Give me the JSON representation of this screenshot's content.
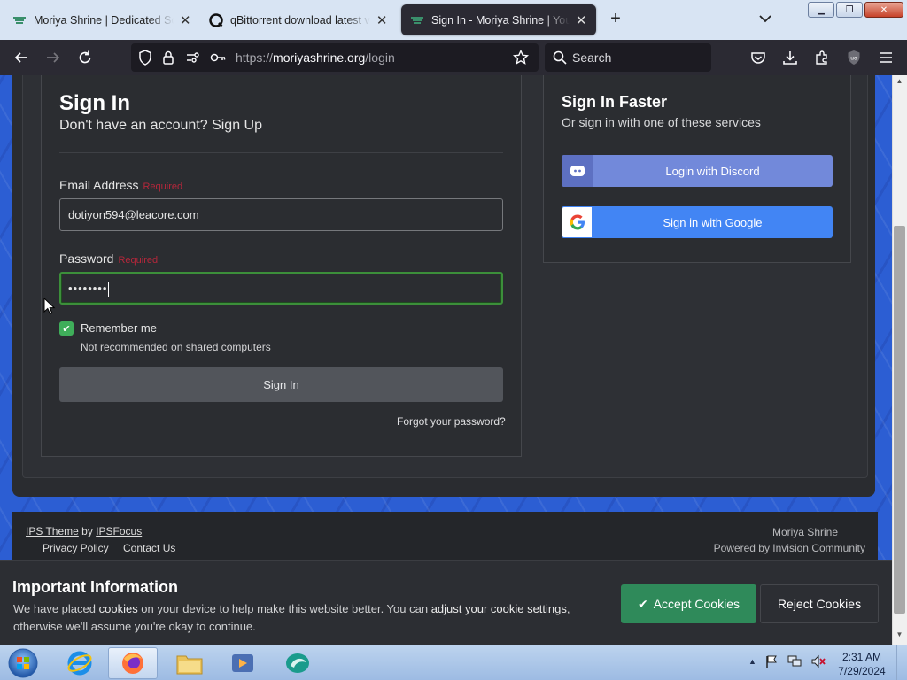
{
  "browser": {
    "tabs": [
      {
        "label": "Moriya Shrine | Dedicated Sound",
        "active": false
      },
      {
        "label": "qBittorrent download latest version",
        "active": false
      },
      {
        "label": "Sign In - Moriya Shrine | Your resource",
        "active": true
      }
    ],
    "url_domain": "moriyashrine.org",
    "url_prefix": "https://",
    "url_path": "/login",
    "search_placeholder": "Search"
  },
  "signin": {
    "title": "Sign In",
    "subtitle": "Don't have an account? Sign Up",
    "email_label": "Email Address",
    "email_required": "Required",
    "email_value": "dotiyon594@leacore.com",
    "password_label": "Password",
    "password_required": "Required",
    "password_value": "••••••••",
    "remember_label": "Remember me",
    "remember_checked": true,
    "remember_note": "Not recommended on shared computers",
    "submit_label": "Sign In",
    "forgot_label": "Forgot your password?"
  },
  "faster": {
    "title": "Sign In Faster",
    "subtitle": "Or sign in with one of these services",
    "discord_label": "Login with Discord",
    "google_label": "Sign in with Google",
    "discord_color": "#7289da",
    "google_color": "#4285f4"
  },
  "footer": {
    "theme_text": "IPS Theme",
    "by_text": "by",
    "focus_text": "IPSFocus",
    "privacy": "Privacy Policy",
    "contact": "Contact Us",
    "site_name": "Moriya Shrine",
    "powered": "Powered by Invision Community"
  },
  "cookie": {
    "title": "Important Information",
    "text_1": "We have placed ",
    "link_1": "cookies",
    "text_2": " on your device to help make this website better. You can ",
    "link_2": "adjust your cookie settings",
    "text_3": ", otherwise we'll assume you're okay to continue.",
    "accept": "Accept Cookies",
    "reject": "Reject Cookies",
    "accept_color": "#2f8a5a"
  },
  "taskbar": {
    "time": "2:31 AM",
    "date": "7/29/2024",
    "apps": [
      "internet-explorer",
      "firefox",
      "file-explorer",
      "media-player",
      "qbittorrent"
    ]
  }
}
